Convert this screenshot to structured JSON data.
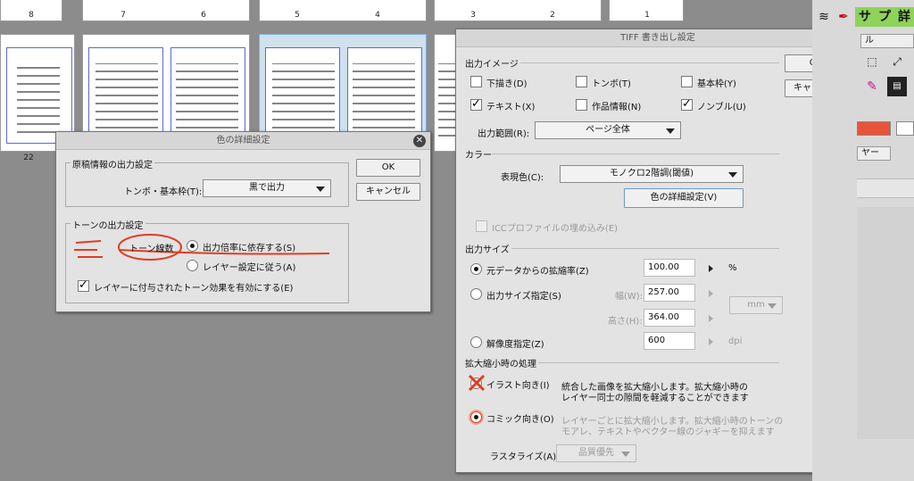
{
  "thumbnails": {
    "top_row_numbers": [
      "8",
      "7",
      "6",
      "5",
      "4",
      "3",
      "2",
      "1"
    ],
    "second_row_number": "22"
  },
  "color_detail_dialog": {
    "title": "色の詳細設定",
    "ok_label": "OK",
    "cancel_label": "キャンセル",
    "manuscript_section": {
      "title": "原稿情報の出力設定",
      "trim_label": "トンボ・基本枠(T):",
      "trim_value": "黒で出力"
    },
    "tone_section": {
      "title": "トーンの出力設定",
      "annotation_label": "トーン線数",
      "radio_depend_output": "出力倍率に依存する(S)",
      "radio_follow_layer": "レイヤー設定に従う(A)",
      "checkbox_layer_tone": "レイヤーに付与されたトーン効果を有効にする(E)"
    }
  },
  "tiff_dialog": {
    "title": "TIFF 書き出し設定",
    "ok_label": "OK",
    "cancel_label": "キャンセル",
    "output_image": {
      "title": "出力イメージ",
      "checks": [
        {
          "label": "下描き(D)",
          "checked": false
        },
        {
          "label": "トンボ(T)",
          "checked": false
        },
        {
          "label": "基本枠(Y)",
          "checked": false
        },
        {
          "label": "テキスト(X)",
          "checked": true
        },
        {
          "label": "作品情報(N)",
          "checked": false
        },
        {
          "label": "ノンブル(U)",
          "checked": true
        }
      ],
      "range_label": "出力範囲(R):",
      "range_value": "ページ全体"
    },
    "color": {
      "title": "カラー",
      "expr_label": "表現色(C):",
      "expr_value": "モノクロ2階調(閾値)",
      "detail_button": "色の詳細設定(V)",
      "icc_label": "ICCプロファイルの埋め込み(E)"
    },
    "output_size": {
      "title": "出力サイズ",
      "scale_label": "元データからの拡縮率(Z)",
      "scale_value": "100.00",
      "scale_unit": "%",
      "size_label": "出力サイズ指定(S)",
      "width_label": "幅(W):",
      "width_value": "257.00",
      "height_label": "高さ(H):",
      "height_value": "364.00",
      "unit_value": "mm",
      "res_label": "解像度指定(Z)",
      "res_value": "600",
      "res_unit": "dpi"
    },
    "scaling": {
      "title": "拡大縮小時の処理",
      "illust_label": "イラスト向き(I)",
      "illust_desc_1": "統合した画像を拡大縮小します。拡大縮小時の",
      "illust_desc_2": "レイヤー同士の隙間を軽減することができます",
      "comic_label": "コミック向き(O)",
      "comic_desc_1": "レイヤーごとに拡大縮小します。拡大縮小時のトーンの",
      "comic_desc_2": "モアレ、テキストやベクター線のジャギーを抑えます",
      "raster_label": "ラスタライズ(A):",
      "raster_value": "品質優先"
    }
  },
  "right_panel": {
    "tab_label": "ル",
    "tab2_label": "ヤー",
    "accent_color": "#e8543a"
  }
}
